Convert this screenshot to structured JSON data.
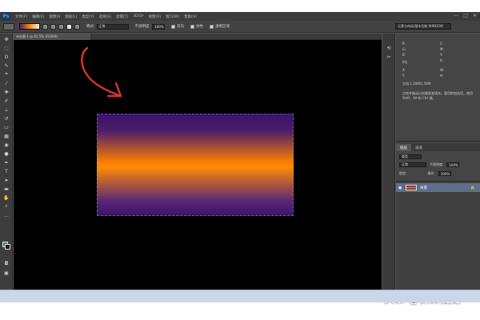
{
  "app": {
    "logo": "Ps"
  },
  "menubar": {
    "items": [
      "文件(F)",
      "编辑(E)",
      "图像(I)",
      "图层(L)",
      "类型(Y)",
      "选择(S)",
      "滤镜(T)",
      "3D(D)",
      "视图(V)",
      "窗口(W)",
      "帮助(H)"
    ],
    "window_controls": [
      "—",
      "□",
      "✕"
    ]
  },
  "options": {
    "mode_label": "模式:",
    "mode_value": "正常",
    "opacity_label": "不透明度:",
    "opacity_value": "100%",
    "reverse_label": "反向",
    "dither_label": "仿色",
    "transparency_label": "透明区域",
    "workspace": "元素与布局/基本功能 WINDOW"
  },
  "document": {
    "tab_title": "未标题-1 @ 62.5% (RGB/8)",
    "zoom": "62.5%",
    "doc_info": "文档:1.50M/1.50M"
  },
  "info_panel": {
    "rows": [
      "R:",
      "G:",
      "B:",
      "8位",
      "X:",
      "Y:",
      "C:",
      "M:",
      "Y:",
      "K:",
      "W:",
      "H:"
    ],
    "doc_line": "文档:1.50M/1.50M",
    "hint": "点按并拖动以创建渐变填充。要用附加选项，使用 Shift、Alt 和 Ctrl 键。"
  },
  "layers": {
    "tabs": [
      "图层",
      "通道"
    ],
    "kind_label": "类型",
    "blend_mode": "正常",
    "opacity_label": "不透明度:",
    "opacity_value": "100%",
    "lock_label": "锁定:",
    "fill_label": "填充:",
    "fill_value": "100%",
    "layer_name": "背景",
    "eye": "●",
    "lock": "🔒"
  },
  "watermark": "头条 @衍果视觉",
  "colors": {
    "gradient_top": "#3b136b",
    "gradient_mid": "#ff7f00",
    "annotation": "#d9362b",
    "foreground": "#3a8a7a",
    "background": "#1b1b1b"
  }
}
